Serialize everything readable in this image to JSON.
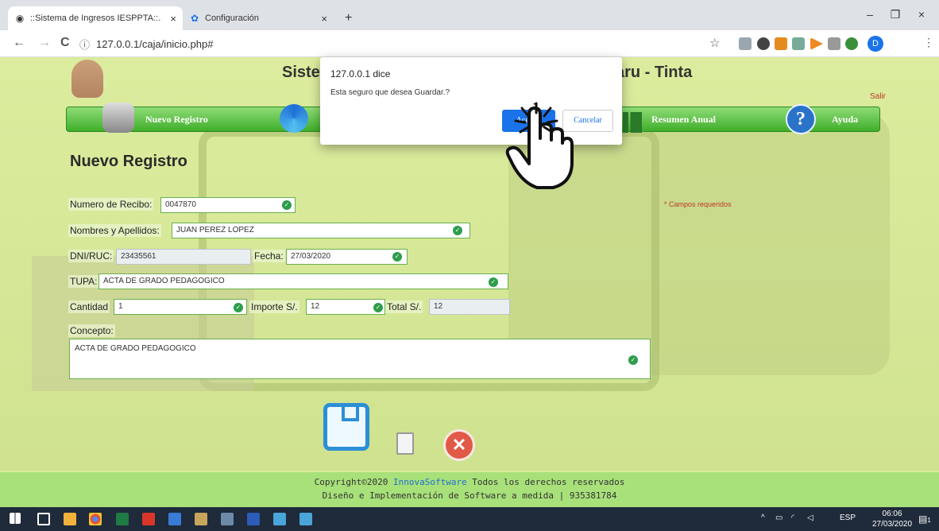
{
  "browser": {
    "tabs": [
      {
        "title": "::Sistema de Ingresos IESPPTA::.",
        "active": true
      },
      {
        "title": "Configuración",
        "active": false
      }
    ],
    "new_tab": "+",
    "url": "127.0.0.1/caja/inicio.php#",
    "nav": {
      "back": "←",
      "forward": "→",
      "reload": "C"
    },
    "profile_initial": "D",
    "window": {
      "minimize": "–",
      "restore": "❐",
      "close": "×"
    }
  },
  "header": {
    "title_left": "Siste",
    "title_right": "aru - Tinta",
    "logout": "Salir"
  },
  "menu": {
    "items": [
      {
        "label": "Nuevo Registro",
        "icon": "database-add-icon"
      },
      {
        "label": "",
        "icon": "refresh-icon"
      },
      {
        "label": "Resumen Anual",
        "icon": "chart-icon"
      },
      {
        "label": "Ayuda",
        "icon": "help-icon"
      }
    ]
  },
  "form": {
    "title": "Nuevo Registro",
    "required_note": "* Campos requeridos",
    "receipt_label": "Numero de Recibo:",
    "receipt_value": "0047870",
    "name_label": "Nombres y Apellidos:",
    "name_value": "JUAN PEREZ LOPEZ",
    "dni_label": "DNI/RUC:",
    "dni_value": "23435561",
    "date_label": "Fecha:",
    "date_value": "27/03/2020",
    "tupa_label": "TUPA:",
    "tupa_value": "ACTA DE GRADO PEDAGOGICO",
    "qty_label": "Cantidad",
    "qty_value": "1",
    "amount_label": "Importe S/.",
    "amount_value": "12",
    "total_label": "Total S/.",
    "total_value": "12",
    "concept_label": "Concepto:",
    "concept_value": "ACTA DE GRADO PEDAGOGICO"
  },
  "dialog": {
    "title": "127.0.0.1 dice",
    "message": "Esta seguro que desea Guardar.?",
    "accept": "Aceptar",
    "cancel": "Cancelar"
  },
  "footer": {
    "line1_pre": "Copyright©2020 ",
    "brand": "InnovaSoftware",
    "line1_post": " Todos los derechos reservados",
    "line2": "Diseño e Implementación de Software a medida | 935381784"
  },
  "taskbar": {
    "lang": "ESP",
    "time": "06:06",
    "date": "27/03/2020",
    "notification_count": "1"
  },
  "colors": {
    "page_bg": "#d9ea9a",
    "menu_green": "#3fae2a",
    "accept_blue": "#1a73e8",
    "required_red": "#c0392b",
    "footer_green": "#a8e07a"
  }
}
